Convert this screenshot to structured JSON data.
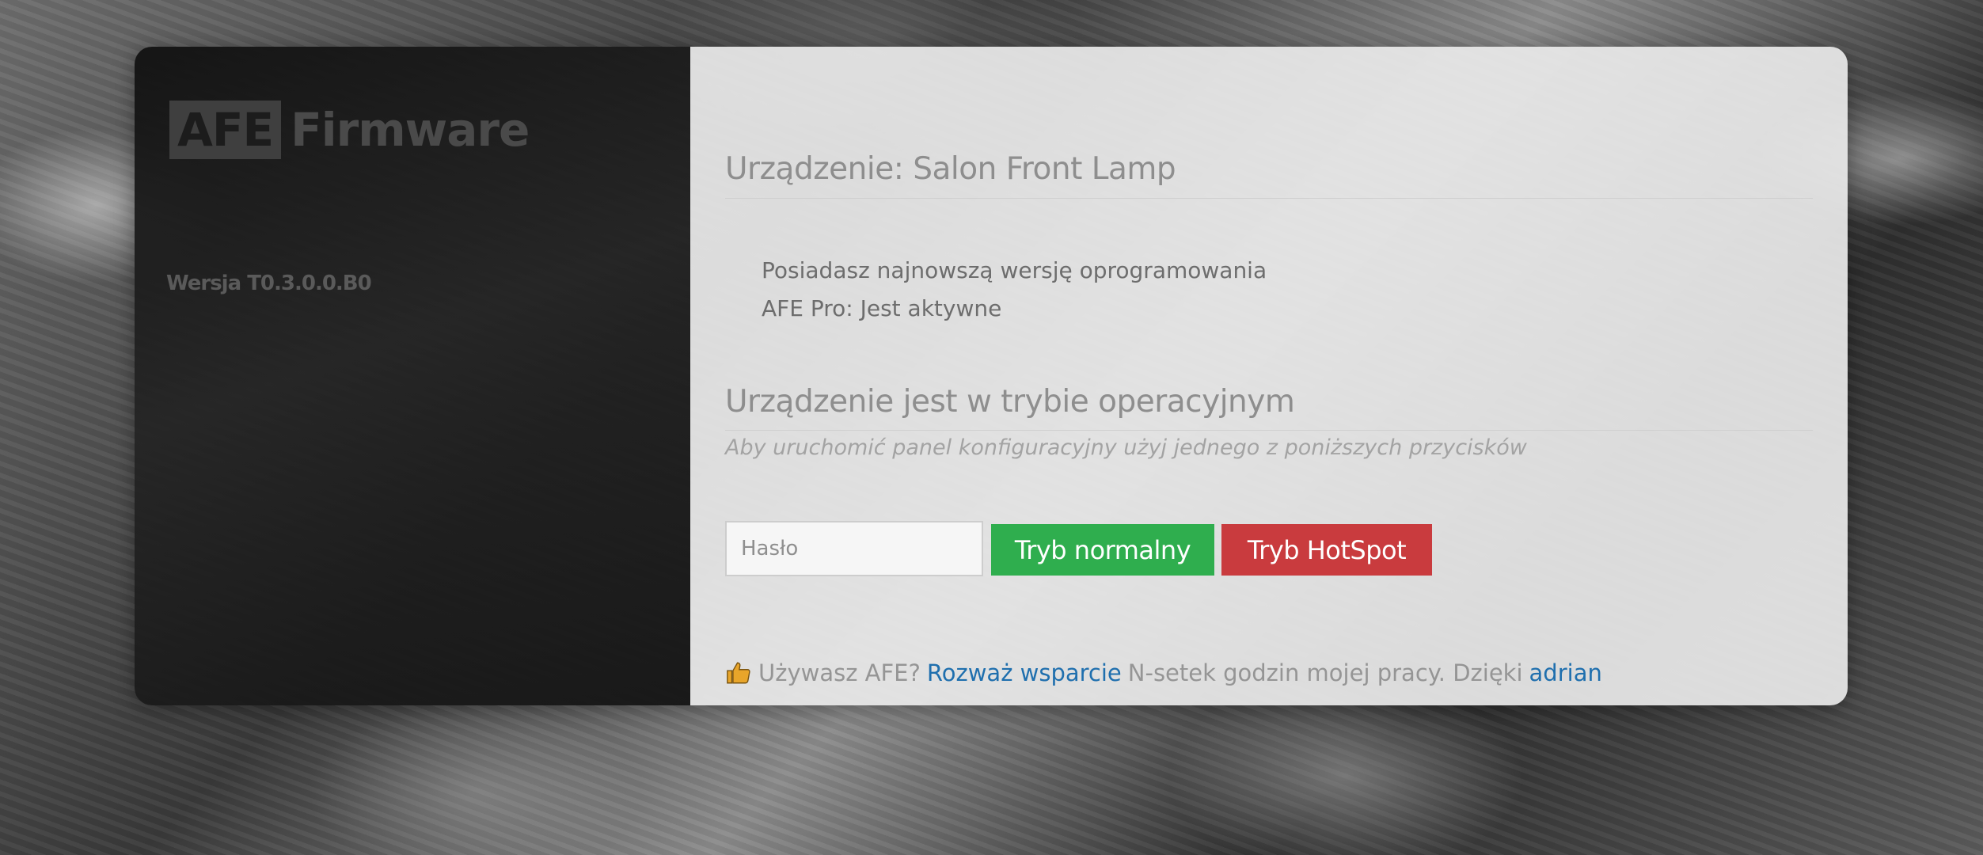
{
  "sidebar": {
    "logo_boxed": "AFE",
    "logo_text": "Firmware",
    "version": "Wersja T0.3.0.0.B0"
  },
  "main": {
    "device_title": "Urządzenie: Salon Front Lamp",
    "info": [
      "Posiadasz najnowszą wersję oprogramowania",
      "AFE Pro: Jest aktywne"
    ],
    "mode_title": "Urządzenie jest w trybie operacyjnym",
    "mode_subtitle": "Aby uruchomić panel konfiguracyjny użyj jednego z poniższych przycisków",
    "password_placeholder": "Hasło",
    "normal_button": "Tryb normalny",
    "hotspot_button": "Tryb HotSpot"
  },
  "footer": {
    "icon": "thumbs-up-icon",
    "text_before": "Używasz AFE?",
    "support_link": "Rozważ wsparcie",
    "text_middle": "N-setek godzin mojej pracy. Dzięki",
    "author_link": "adrian"
  },
  "colors": {
    "accent_green": "#2fae4e",
    "accent_red": "#c93b3e",
    "link_blue": "#1f6fae",
    "thumb_yellow": "#e8a52a"
  }
}
